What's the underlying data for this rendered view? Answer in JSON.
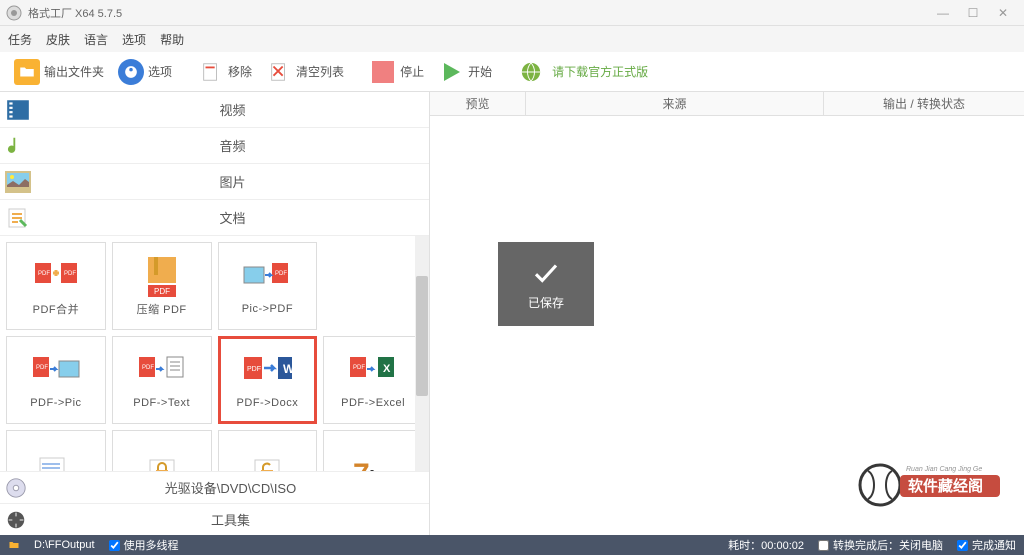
{
  "title": "格式工厂 X64 5.7.5",
  "menu": [
    "任务",
    "皮肤",
    "语言",
    "选项",
    "帮助"
  ],
  "toolbar": {
    "output_folder": "输出文件夹",
    "options": "选项",
    "remove": "移除",
    "clear_list": "清空列表",
    "stop": "停止",
    "start": "开始",
    "download_official": "请下载官方正式版"
  },
  "categories": {
    "video": "视频",
    "audio": "音频",
    "image": "图片",
    "document": "文档",
    "optical": "光驱设备\\DVD\\CD\\ISO",
    "toolset": "工具集"
  },
  "doc_cells": [
    {
      "label": "PDF合并"
    },
    {
      "label": "压缩 PDF"
    },
    {
      "label": "Pic->PDF"
    },
    {
      "label": "PDF->Pic"
    },
    {
      "label": "PDF->Text"
    },
    {
      "label": "PDF->Docx"
    },
    {
      "label": "PDF->Excel"
    }
  ],
  "selected_cell_index": 5,
  "headers": {
    "preview": "预览",
    "source": "来源",
    "status": "输出 / 转换状态"
  },
  "saved_label": "已保存",
  "status": {
    "output_path": "D:\\FFOutput",
    "multithread": "使用多线程",
    "elapsed": "耗时：00:00:02",
    "shutdown_after": "转换完成后：关闭电脑",
    "notify": "完成通知"
  }
}
